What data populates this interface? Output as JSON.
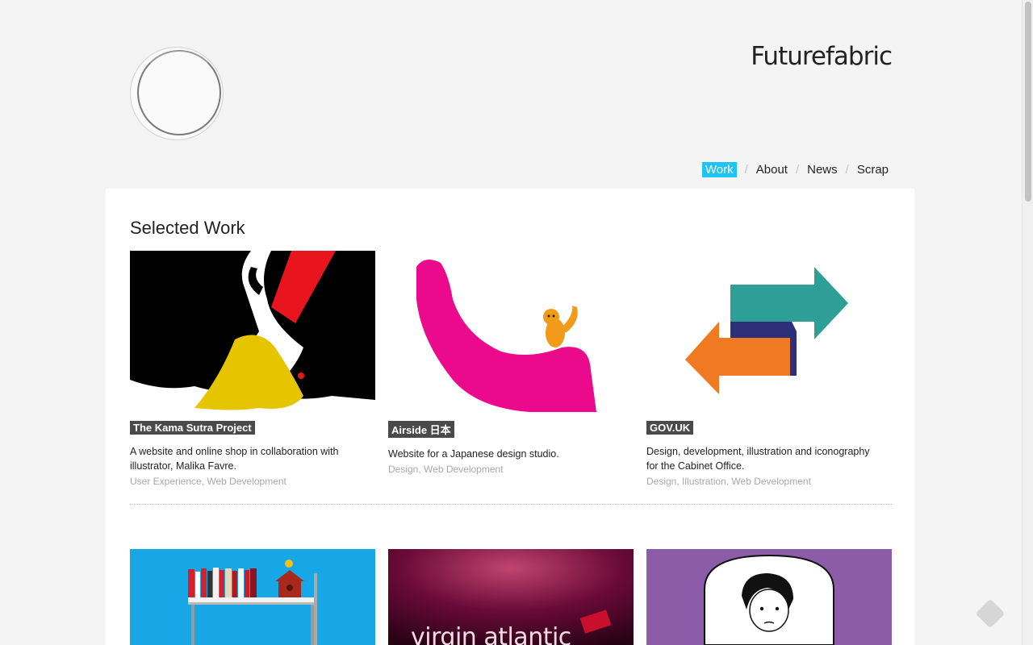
{
  "header": {
    "brand": "Futurefabric"
  },
  "nav": {
    "items": [
      {
        "label": "Work",
        "active": true
      },
      {
        "label": "About",
        "active": false
      },
      {
        "label": "News",
        "active": false
      },
      {
        "label": "Scrap",
        "active": false
      }
    ],
    "separator": "/"
  },
  "main": {
    "heading": "Selected Work",
    "projects": [
      {
        "title": "The Kama Sutra Project",
        "description": "A website and online shop in collaboration with illustrator, Malika Favre.",
        "categories": [
          "User Experience",
          "Web Development"
        ]
      },
      {
        "title": "Airside 日本",
        "description": "Website for a Japanese design studio.",
        "categories": [
          "Design",
          "Web Development"
        ]
      },
      {
        "title": "GOV.UK",
        "description": "Design, development, illustration and iconography for the Cabinet Office.",
        "categories": [
          "Design",
          "Illustration",
          "Web Development"
        ]
      }
    ],
    "row2_texts": {
      "virgin": "virgin atlantic"
    }
  },
  "colors": {
    "accent": "#1ec4f2",
    "tag_bg": "#4a4a4a",
    "kama_bg": "#000000",
    "airside_pink": "#ec0a8c",
    "gov_teal": "#2e9f97",
    "gov_orange": "#ef7a22",
    "gov_navy": "#2d2f7a",
    "shelf_blue": "#18a7e6",
    "virgin_dark": "#5a0630",
    "purple": "#8c5ca8"
  }
}
